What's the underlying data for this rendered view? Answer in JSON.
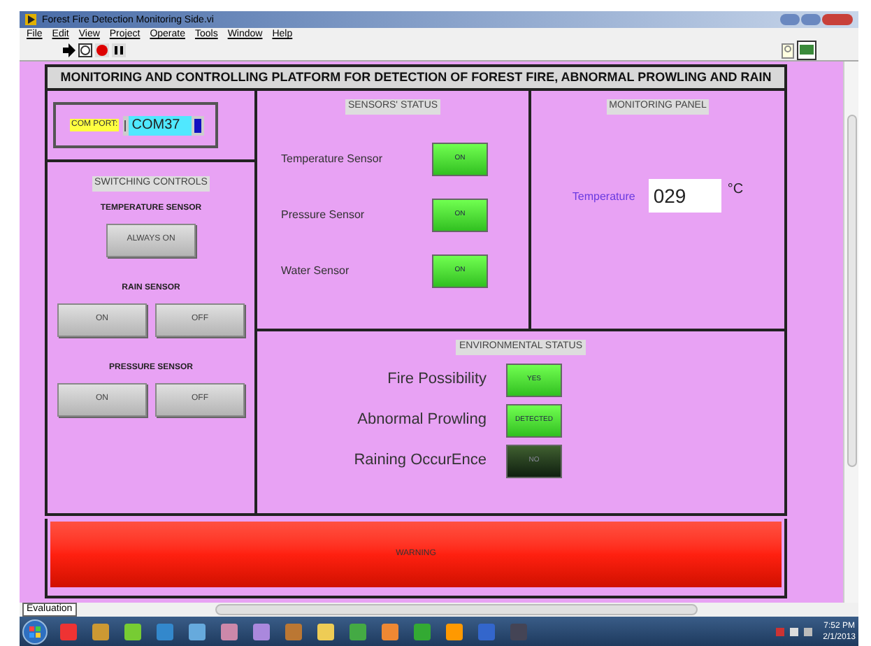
{
  "window": {
    "title": "Forest Fire Detection Monitoring Side.vi"
  },
  "menu": [
    "File",
    "Edit",
    "View",
    "Project",
    "Operate",
    "Tools",
    "Window",
    "Help"
  ],
  "main_title": "MONITORING AND CONTROLLING PLATFORM FOR DETECTION OF FOREST FIRE, ABNORMAL PROWLING AND RAIN",
  "com_port": {
    "label": "COM PORT:",
    "value": "COM37"
  },
  "switching_controls": {
    "title": "SWITCHING CONTROLS",
    "groups": [
      {
        "label": "TEMPERATURE SENSOR",
        "buttons": [
          "ALWAYS ON"
        ]
      },
      {
        "label": "RAIN SENSOR",
        "buttons": [
          "ON",
          "OFF"
        ]
      },
      {
        "label": "PRESSURE SENSOR",
        "buttons": [
          "ON",
          "OFF"
        ]
      }
    ]
  },
  "sensors_status": {
    "title": "SENSORS' STATUS",
    "rows": [
      {
        "label": "Temperature Sensor",
        "indicator": "ON",
        "on": true
      },
      {
        "label": "Pressure Sensor",
        "indicator": "ON",
        "on": true
      },
      {
        "label": "Water Sensor",
        "indicator": "ON",
        "on": true
      }
    ]
  },
  "monitoring_panel": {
    "title": "MONITORING PANEL",
    "label": "Temperature",
    "value": "029",
    "unit": "°C"
  },
  "environmental_status": {
    "title": "ENVIRONMENTAL STATUS",
    "rows": [
      {
        "label": "Fire Possibility",
        "indicator": "YES",
        "on": true
      },
      {
        "label": "Abnormal Prowling",
        "indicator": "DETECTED",
        "on": true
      },
      {
        "label": "Raining OccurEnce",
        "indicator": "NO",
        "on": false
      }
    ]
  },
  "warning": {
    "text": "WARNING",
    "on": true
  },
  "status_bar": {
    "tab": "Evaluation"
  },
  "taskbar": {
    "time": "7:52 PM",
    "date": "2/1/2013"
  }
}
